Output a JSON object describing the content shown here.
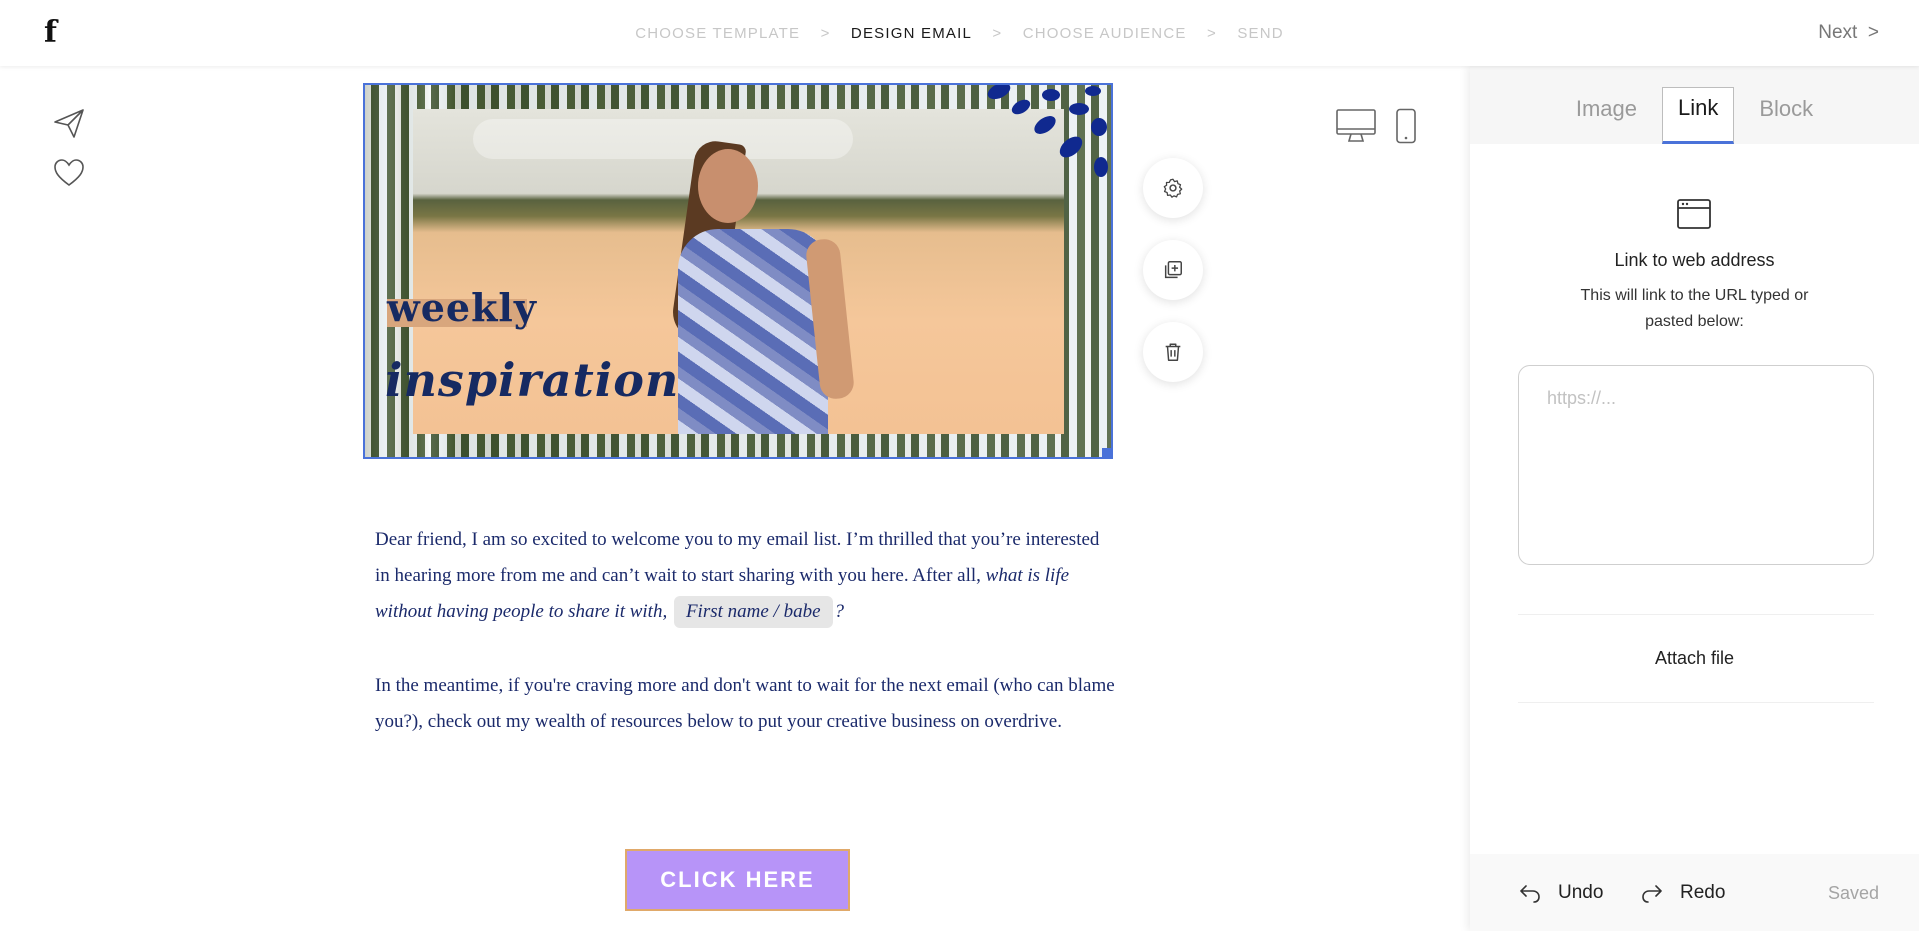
{
  "app": {
    "logo": "f"
  },
  "steps": [
    {
      "label": "CHOOSE TEMPLATE"
    },
    {
      "label": "DESIGN EMAIL"
    },
    {
      "label": "CHOOSE AUDIENCE"
    },
    {
      "label": "SEND"
    }
  ],
  "step_separator": ">",
  "header": {
    "next_label": "Next",
    "next_chevron": ">"
  },
  "hero": {
    "line1": "weekly",
    "line2": "inspiration"
  },
  "body": {
    "para1_a": "Dear friend, I am so excited to welcome you to my email list. I’m thrilled that you’re interested in hearing more from me and can’t wait to start sharing with you here. After all,",
    "para1_italic": "what is life without having people to share it with,",
    "merge_tag": "First name / babe",
    "para1_end": "?",
    "para2": "In the meantime, if you're craving more and don't want to wait for the next email (who can blame you?), check out my wealth of resources below to put your creative business on overdrive."
  },
  "cta": {
    "label": "CLICK HERE"
  },
  "panel": {
    "tabs": [
      {
        "label": "Image"
      },
      {
        "label": "Link"
      },
      {
        "label": "Block"
      }
    ],
    "active_tab": "Link",
    "link_title": "Link to web address",
    "link_desc": "This will link to the URL typed or pasted below:",
    "url_placeholder": "https://...",
    "url_value": "",
    "attach_label": "Attach file",
    "undo_label": "Undo",
    "redo_label": "Redo",
    "status": "Saved"
  },
  "colors": {
    "accent": "#4a72d9",
    "cta_bg": "#b794f8",
    "body_text": "#1b2a6b"
  },
  "icons": [
    "send-icon",
    "heart-icon",
    "gear-icon",
    "duplicate-icon",
    "trash-icon",
    "desktop-icon",
    "mobile-icon",
    "browser-window-icon",
    "undo-icon",
    "redo-icon"
  ]
}
